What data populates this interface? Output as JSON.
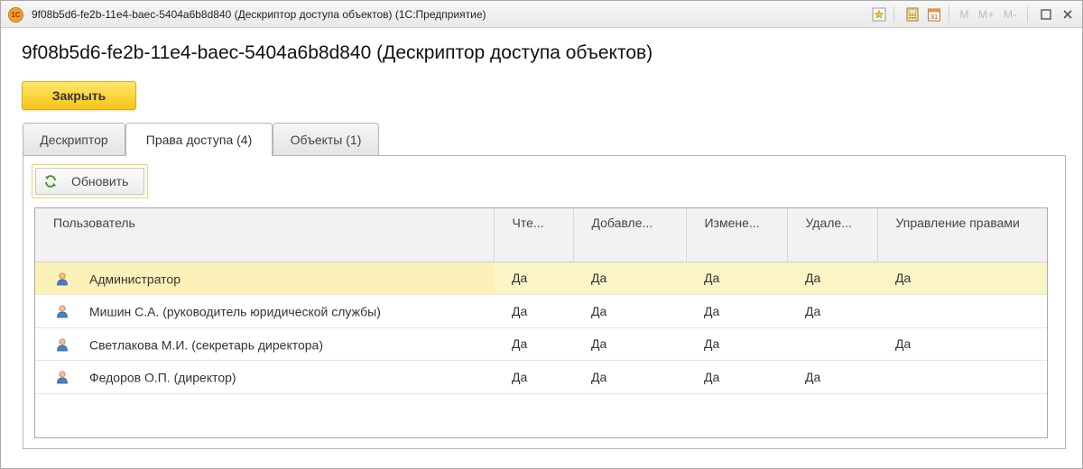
{
  "window": {
    "title": "9f08b5d6-fe2b-11e4-baec-5404a6b8d840 (Дескриптор доступа объектов)  (1С:Предприятие)",
    "logo_text": "1С",
    "memory_labels": [
      "M",
      "M+",
      "M-"
    ],
    "calendar_day": "31"
  },
  "header": {
    "title": "9f08b5d6-fe2b-11e4-baec-5404a6b8d840 (Дескриптор доступа объектов)",
    "close_label": "Закрыть"
  },
  "tabs": [
    {
      "label": "Дескриптор",
      "active": false
    },
    {
      "label": "Права доступа (4)",
      "active": true
    },
    {
      "label": "Объекты (1)",
      "active": false
    }
  ],
  "toolbar": {
    "refresh_label": "Обновить"
  },
  "table": {
    "columns": [
      "Пользователь",
      "Чте...",
      "Добавле...",
      "Измене...",
      "Удале...",
      "Управление правами"
    ],
    "rows": [
      {
        "user": "Администратор",
        "read": "Да",
        "add": "Да",
        "change": "Да",
        "delete": "Да",
        "manage": "Да",
        "selected": true
      },
      {
        "user": "Мишин С.А. (руководитель юридической службы)",
        "read": "Да",
        "add": "Да",
        "change": "Да",
        "delete": "Да",
        "manage": "",
        "selected": false
      },
      {
        "user": "Светлакова М.И. (секретарь директора)",
        "read": "Да",
        "add": "Да",
        "change": "Да",
        "delete": "",
        "manage": "Да",
        "selected": false
      },
      {
        "user": "Федоров О.П. (директор)",
        "read": "Да",
        "add": "Да",
        "change": "Да",
        "delete": "Да",
        "manage": "",
        "selected": false
      }
    ]
  },
  "icons": {
    "titlebar": [
      "star-icon",
      "calculator-icon",
      "calendar-icon",
      "restore-icon",
      "close-icon"
    ],
    "refresh": "refresh-icon",
    "user": "user-icon"
  },
  "colors": {
    "accent_button": "#f5c518",
    "selected_row": "#fbf4c6",
    "refresh_focus": "#f2d35a"
  }
}
